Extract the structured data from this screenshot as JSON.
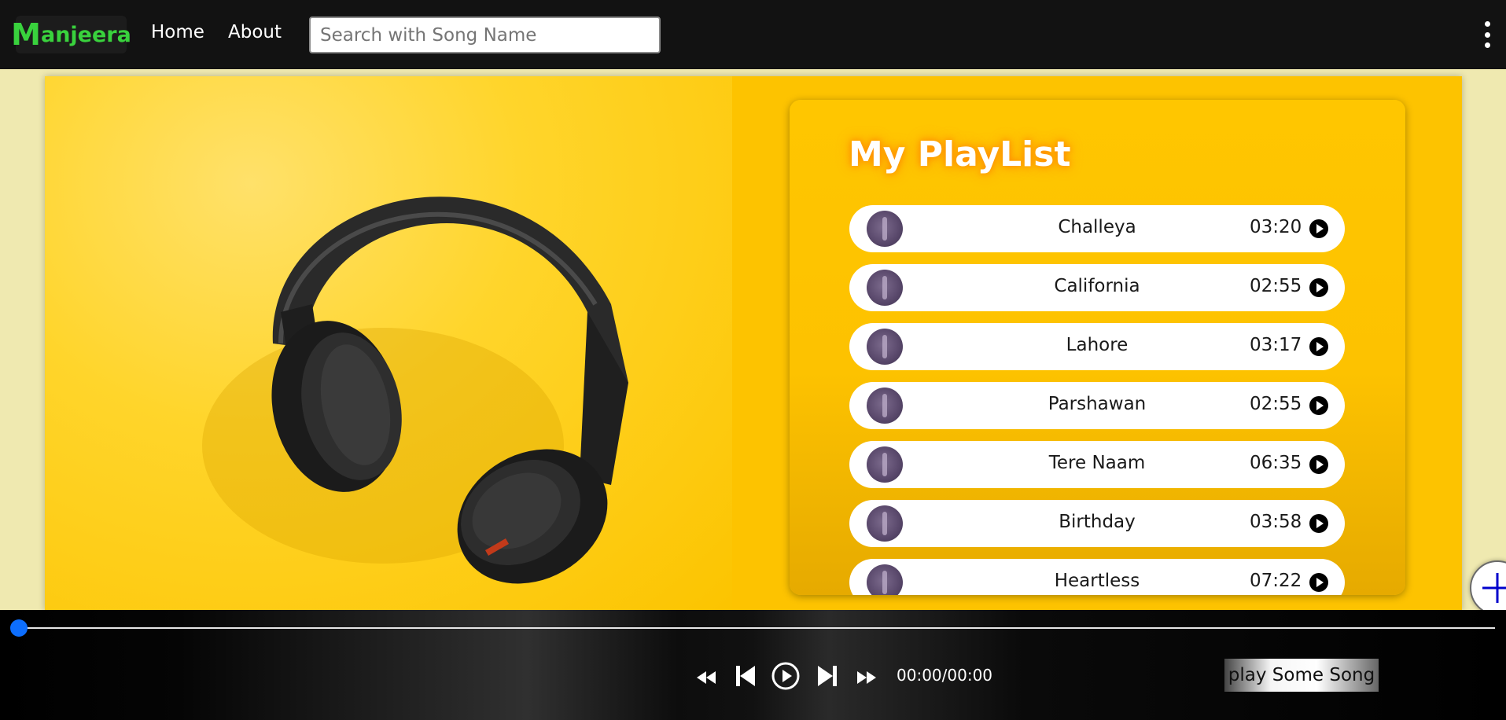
{
  "nav": {
    "brand_first": "M",
    "brand_rest": "anjeera",
    "links": [
      "Home",
      "About"
    ],
    "search_placeholder": "Search with Song Name",
    "menu_icon": "kebab-menu-icon"
  },
  "hero": {
    "image": "yellow-background-headphones-photo"
  },
  "playlist": {
    "title": "My PlayList",
    "songs": [
      {
        "name": "Challeya",
        "duration": "03:20"
      },
      {
        "name": "California",
        "duration": "02:55"
      },
      {
        "name": "Lahore",
        "duration": "03:17"
      },
      {
        "name": "Parshawan",
        "duration": "02:55"
      },
      {
        "name": "Tere Naam",
        "duration": "06:35"
      },
      {
        "name": "Birthday",
        "duration": "03:58"
      },
      {
        "name": "Heartless",
        "duration": "07:22"
      }
    ]
  },
  "fab": {
    "icon": "plus-icon"
  },
  "player": {
    "progress": 0,
    "time": "00:00/00:00",
    "now_playing": "play Some Song",
    "controls": [
      "backward-icon",
      "previous-icon",
      "play-icon",
      "next-icon",
      "forward-icon"
    ]
  },
  "colors": {
    "brand": "#39d23d",
    "accent_yellow": "#fdc300",
    "seek": "#0d6efd",
    "fab_plus": "#0000cc"
  }
}
